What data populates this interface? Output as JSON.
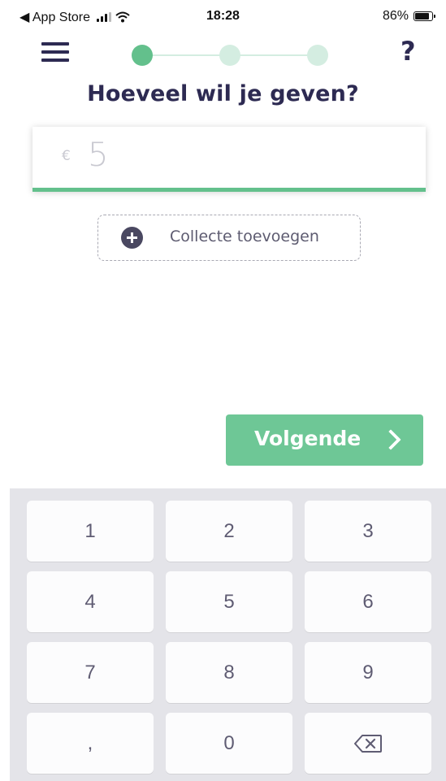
{
  "status_bar": {
    "back_app": "◀ App Store",
    "time": "18:28",
    "battery": "86%"
  },
  "header": {
    "menu_icon": "hamburger-menu-icon",
    "help_label": "?",
    "steps": {
      "total": 3,
      "current": 1
    }
  },
  "title": "Hoeveel wil je geven?",
  "amount": {
    "currency": "€",
    "value": "5"
  },
  "collecte": {
    "icon": "plus-circle-icon",
    "label": "Collecte toevoegen"
  },
  "next_button": {
    "label": "Volgende",
    "icon": "chevron-right-icon"
  },
  "keypad": {
    "keys": [
      "1",
      "2",
      "3",
      "4",
      "5",
      "6",
      "7",
      "8",
      "9",
      ",",
      "0",
      "⌫"
    ],
    "backspace_icon": "backspace-icon"
  },
  "colors": {
    "primary": "#2d2a52",
    "accent_green": "#63c08c",
    "button_green": "#6ec796",
    "keypad_bg": "#e4e4e9"
  }
}
